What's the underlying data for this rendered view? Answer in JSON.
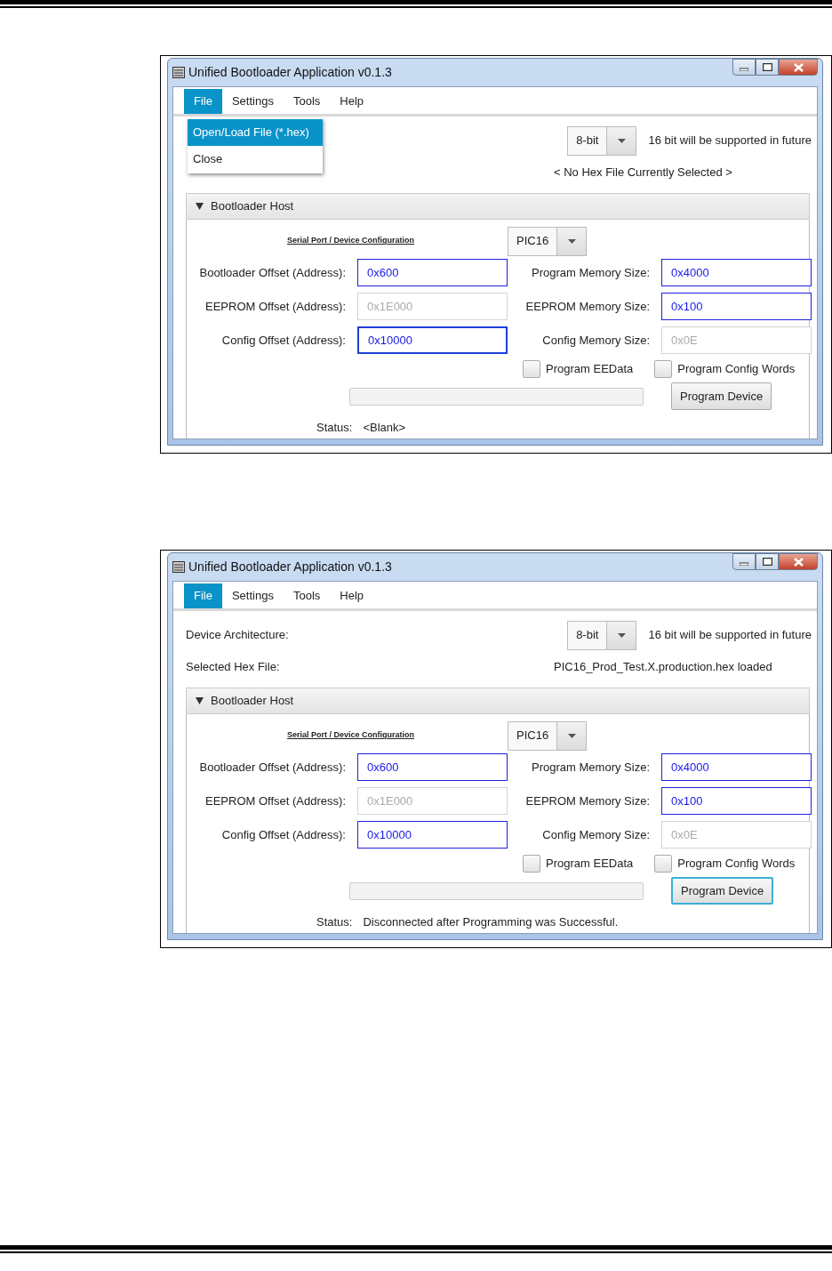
{
  "windows": [
    {
      "title": "Unified Bootloader Application v0.1.3",
      "menu": [
        {
          "label": "File",
          "selected": true
        },
        {
          "label": "Settings",
          "selected": false
        },
        {
          "label": "Tools",
          "selected": false
        },
        {
          "label": "Help",
          "selected": false
        }
      ],
      "open_menu": [
        {
          "label": "Open/Load File (*.hex)",
          "selected": true
        },
        {
          "label": "Close",
          "selected": false
        }
      ],
      "architecture": {
        "value": "8-bit",
        "note": "16 bit will be supported in future"
      },
      "hex_file": {
        "value": "< No Hex File Currently Selected >"
      },
      "section": {
        "title": "Bootloader Host",
        "expanded": true
      },
      "config_link": "Serial Port / Device Configuration",
      "device": "PIC16",
      "fields": [
        {
          "label": "Bootloader Offset (Address):",
          "value": "0x600",
          "disabled": false,
          "focused": false
        },
        {
          "label": "Program Memory Size:",
          "value": "0x4000",
          "disabled": false,
          "focused": false
        },
        {
          "label": "EEPROM Offset (Address):",
          "value": "0x1E000",
          "disabled": true,
          "focused": false
        },
        {
          "label": "EEPROM Memory Size:",
          "value": "0x100",
          "disabled": false,
          "focused": false
        },
        {
          "label": "Config Offset (Address):",
          "value": "0x10000",
          "disabled": false,
          "focused": true
        },
        {
          "label": "Config Memory Size:",
          "value": "0x0E",
          "disabled": true,
          "focused": false
        }
      ],
      "checkboxes": [
        {
          "label": "Program EEData",
          "checked": false
        },
        {
          "label": "Program Config Words",
          "checked": false
        }
      ],
      "progress": {
        "level": 0
      },
      "program_button": {
        "label": "Program Device",
        "focused": false
      },
      "status": {
        "label": "Status:",
        "value": "<Blank>"
      }
    },
    {
      "title": "Unified Bootloader Application v0.1.3",
      "menu": [
        {
          "label": "File",
          "selected": true
        },
        {
          "label": "Settings",
          "selected": false
        },
        {
          "label": "Tools",
          "selected": false
        },
        {
          "label": "Help",
          "selected": false
        }
      ],
      "architecture": {
        "label": "Device Architecture:",
        "value": "8-bit",
        "note": "16 bit will be supported in future"
      },
      "hex_file": {
        "label": "Selected Hex File:",
        "value": "PIC16_Prod_Test.X.production.hex loaded"
      },
      "section": {
        "title": "Bootloader Host",
        "expanded": true
      },
      "config_link": "Serial Port / Device Configuration",
      "device": "PIC16",
      "fields": [
        {
          "label": "Bootloader Offset (Address):",
          "value": "0x600",
          "disabled": false,
          "focused": false
        },
        {
          "label": "Program Memory Size:",
          "value": "0x4000",
          "disabled": false,
          "focused": false
        },
        {
          "label": "EEPROM Offset (Address):",
          "value": "0x1E000",
          "disabled": true,
          "focused": false
        },
        {
          "label": "EEPROM Memory Size:",
          "value": "0x100",
          "disabled": false,
          "focused": false
        },
        {
          "label": "Config Offset (Address):",
          "value": "0x10000",
          "disabled": false,
          "focused": false
        },
        {
          "label": "Config Memory Size:",
          "value": "0x0E",
          "disabled": true,
          "focused": false
        }
      ],
      "checkboxes": [
        {
          "label": "Program EEData",
          "checked": false
        },
        {
          "label": "Program Config Words",
          "checked": false
        }
      ],
      "progress": {
        "level": 0
      },
      "program_button": {
        "label": "Program Device",
        "focused": true
      },
      "status": {
        "label": "Status:",
        "value": "Disconnected after Programming was Successful."
      }
    }
  ]
}
